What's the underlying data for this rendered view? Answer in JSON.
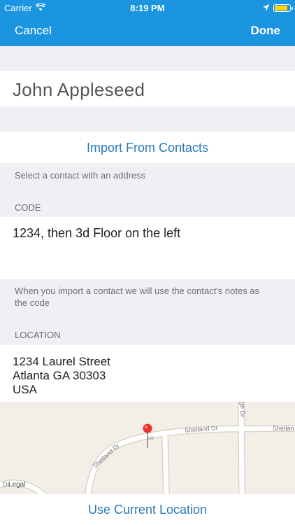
{
  "status_bar": {
    "carrier": "Carrier",
    "time": "8:19 PM",
    "icons": [
      "wifi-icon",
      "location-arrow-icon",
      "battery-icon"
    ]
  },
  "nav": {
    "cancel_label": "Cancel",
    "done_label": "Done"
  },
  "form": {
    "name_value": "John Appleseed",
    "import_label": "Import From Contacts",
    "import_footer": "Select a contact with an address",
    "code_header": "CODE",
    "code_value": "1234, then 3d Floor on the left",
    "code_footer_1": "When you import a contact we will use the contact's notes as",
    "code_footer_2": "the code",
    "location_header": "LOCATION",
    "address": {
      "line1": "1234 Laurel Street",
      "line2": "Atlanta GA 30303",
      "line3": "USA"
    }
  },
  "map": {
    "street_1": "Shetland Dr",
    "street_2": "Shetland Dr",
    "street_3": "Shetland Dr",
    "street_4": "Shetlan",
    "street_5": "ge Dr",
    "street_6": "Dr",
    "legal": "Legal",
    "pin_color": "#e8302c"
  },
  "bottom": {
    "use_location_label": "Use Current Location"
  },
  "colors": {
    "accent": "#1c95e0",
    "link": "#2a7ab8"
  }
}
